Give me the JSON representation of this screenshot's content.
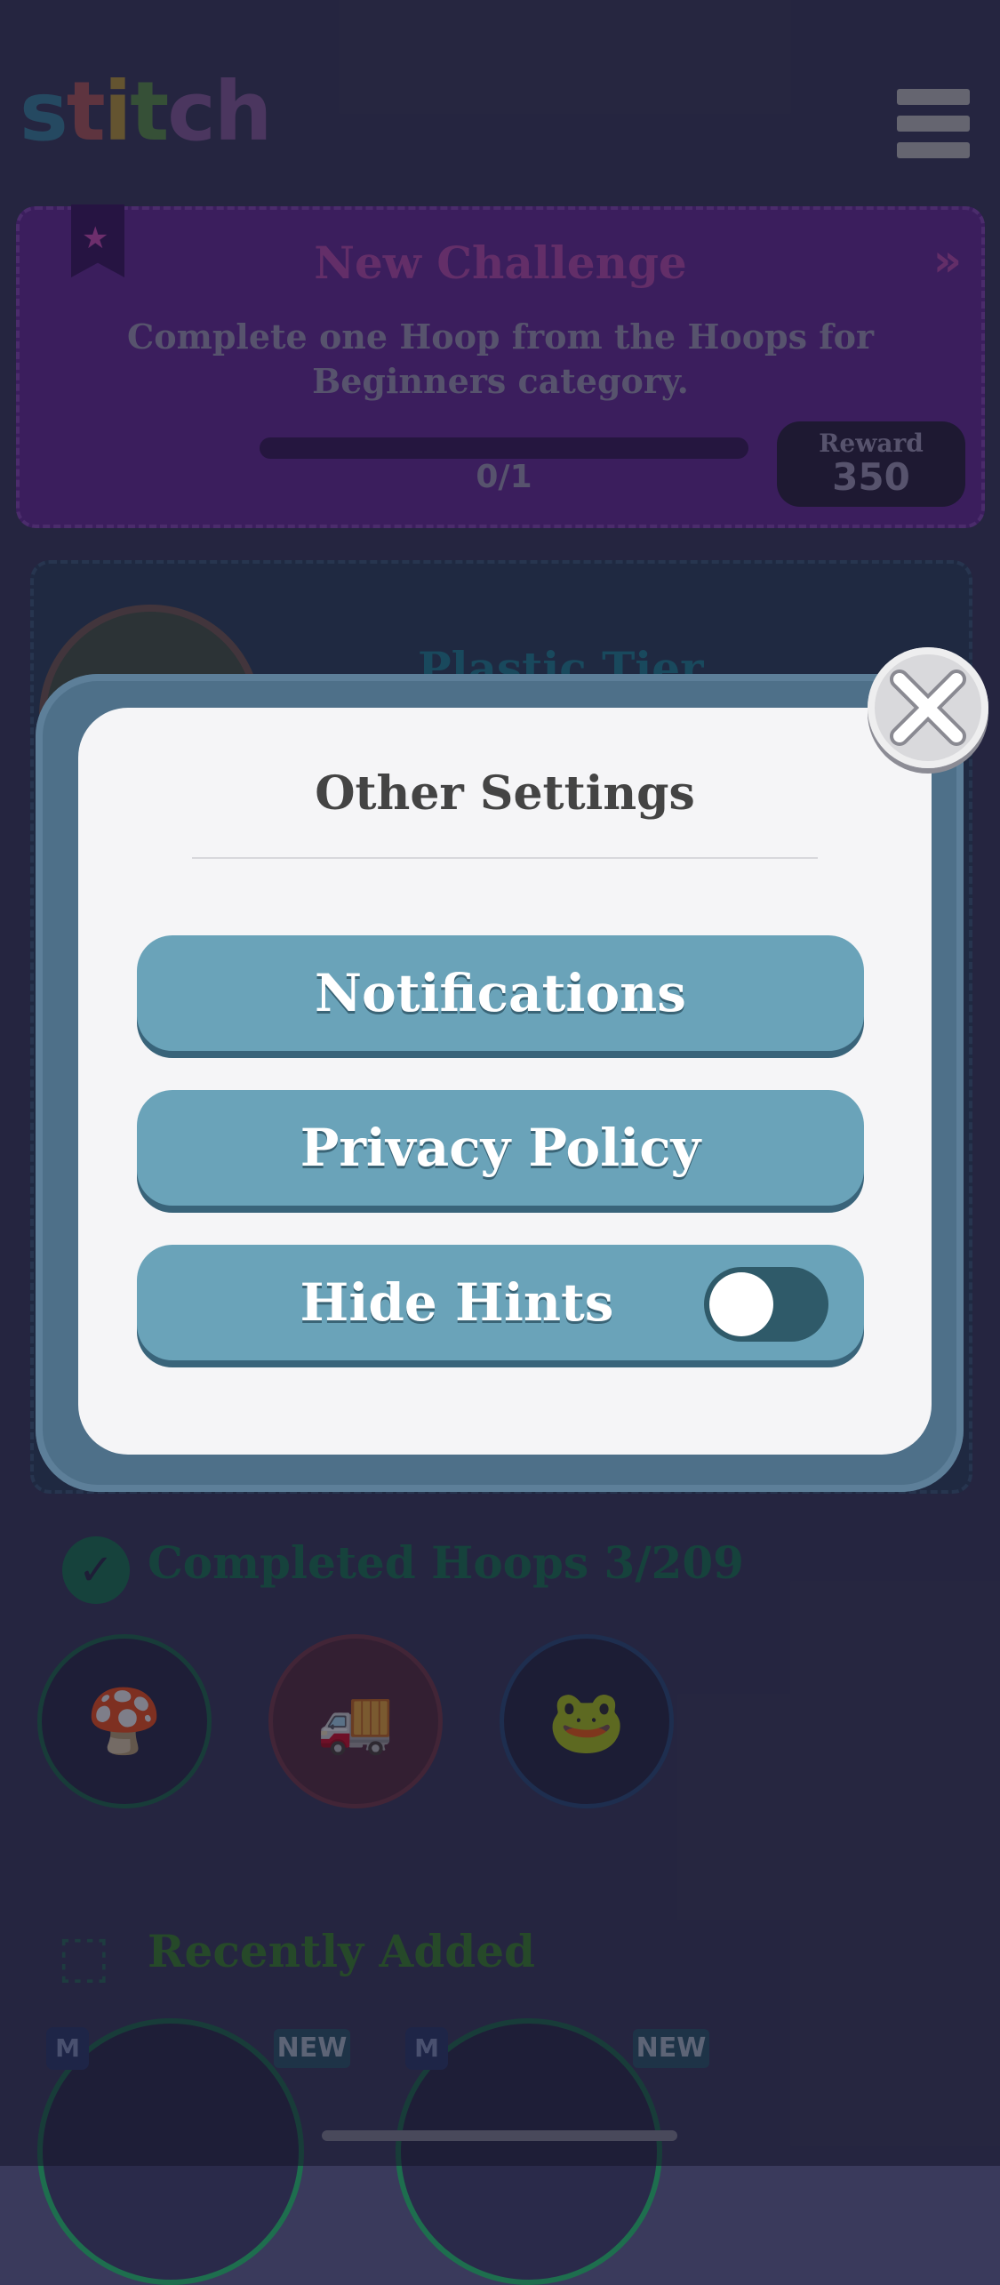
{
  "app": {
    "logo_text_1": "s",
    "logo_text_2": "t",
    "logo_text_3": "i",
    "logo_text_4": "t",
    "logo_text_5": "ch"
  },
  "challenge": {
    "title": "New Challenge",
    "description": "Complete one Hoop from the Hoops for Beginners category.",
    "progress_text": "0/1",
    "progress_fraction": 0,
    "reward_label": "Reward",
    "reward_value": "350"
  },
  "tier": {
    "title": "Plastic Tier"
  },
  "completed": {
    "title": "Completed Hoops 3/209"
  },
  "recent": {
    "title": "Recently Added",
    "badge_new": "NEW",
    "badge_m": "M"
  },
  "modal": {
    "title": "Other Settings",
    "notifications_label": "Notifications",
    "privacy_label": "Privacy Policy",
    "hide_hints_label": "Hide Hints",
    "hide_hints_on": false
  },
  "colors": {
    "accent": "#6aa3b9",
    "challenge_bg": "#6a2a9e",
    "tier_title": "#1f8a9e"
  },
  "icons": {
    "menu": "hamburger-menu-icon",
    "close": "close-x-icon",
    "check": "check-circle-icon",
    "box": "gift-box-icon",
    "star": "star-icon",
    "chevrons": "double-chevron-right-icon"
  }
}
